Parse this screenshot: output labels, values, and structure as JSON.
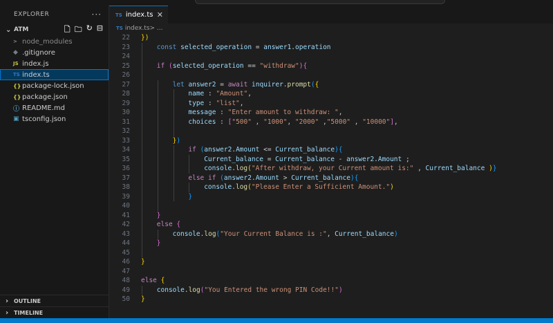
{
  "explorer": {
    "title": "EXPLORER",
    "more": "···",
    "folder": "ATM",
    "items": [
      {
        "label": "node_modules",
        "icon": "chevron-right-icon",
        "glyph": ">",
        "kind": "folder",
        "selected": false
      },
      {
        "label": ".gitignore",
        "icon": "git-icon",
        "glyph": "◆",
        "kind": "git",
        "selected": false
      },
      {
        "label": "index.js",
        "icon": "js-file-icon",
        "glyph": "JS",
        "kind": "js",
        "selected": false
      },
      {
        "label": "index.ts",
        "icon": "ts-file-icon",
        "glyph": "TS",
        "kind": "ts",
        "selected": true
      },
      {
        "label": "package-lock.json",
        "icon": "json-file-icon",
        "glyph": "{}",
        "kind": "json",
        "selected": false
      },
      {
        "label": "package.json",
        "icon": "json-file-icon",
        "glyph": "{}",
        "kind": "json",
        "selected": false
      },
      {
        "label": "README.md",
        "icon": "info-icon",
        "glyph": "ⓘ",
        "kind": "info",
        "selected": false
      },
      {
        "label": "tsconfig.json",
        "icon": "tsconfig-file-icon",
        "glyph": "▣",
        "kind": "cfg",
        "selected": false
      }
    ],
    "outline": "OUTLINE",
    "timeline": "TIMELINE"
  },
  "tab": {
    "label": "index.ts",
    "badge": "TS",
    "close": "✕"
  },
  "breadcrumb": {
    "file": "index.ts",
    "rest": " > ..."
  },
  "code": [
    {
      "n": "22",
      "i": 0,
      "t": [
        [
          "pn",
          "})"
        ]
      ]
    },
    {
      "n": "23",
      "i": 1,
      "t": [
        [
          "kw",
          "const "
        ],
        [
          "v",
          "selected_operation"
        ],
        [
          "",
          " = "
        ],
        [
          "v",
          "answer1"
        ],
        [
          "",
          "."
        ],
        [
          "v",
          "operation"
        ]
      ]
    },
    {
      "n": "24",
      "i": 1,
      "t": []
    },
    {
      "n": "25",
      "i": 1,
      "t": [
        [
          "ctl",
          "if "
        ],
        [
          "pm",
          "("
        ],
        [
          "v",
          "selected_operation"
        ],
        [
          "",
          " == "
        ],
        [
          "str",
          "\"withdraw\""
        ],
        [
          "pm",
          ")"
        ],
        [
          "pm",
          "{"
        ]
      ]
    },
    {
      "n": "26",
      "i": 1,
      "t": []
    },
    {
      "n": "27",
      "i": 2,
      "t": [
        [
          "kw",
          "let "
        ],
        [
          "v",
          "answer2"
        ],
        [
          "",
          " = "
        ],
        [
          "ctl",
          "await "
        ],
        [
          "v",
          "inquirer"
        ],
        [
          "",
          "."
        ],
        [
          "fn",
          "prompt"
        ],
        [
          "pb",
          "("
        ],
        [
          "pn",
          "{"
        ]
      ]
    },
    {
      "n": "28",
      "i": 3,
      "t": [
        [
          "v",
          "name"
        ],
        [
          "",
          " : "
        ],
        [
          "str",
          "\"Amount\""
        ],
        [
          "",
          ","
        ]
      ]
    },
    {
      "n": "29",
      "i": 3,
      "t": [
        [
          "v",
          "type"
        ],
        [
          "",
          " : "
        ],
        [
          "str",
          "\"list\""
        ],
        [
          "",
          ","
        ]
      ]
    },
    {
      "n": "30",
      "i": 3,
      "t": [
        [
          "v",
          "message"
        ],
        [
          "",
          " : "
        ],
        [
          "str",
          "\"Enter amount to withdraw: \""
        ],
        [
          "",
          ","
        ]
      ]
    },
    {
      "n": "31",
      "i": 3,
      "t": [
        [
          "v",
          "choices"
        ],
        [
          "",
          " : "
        ],
        [
          "pm",
          "["
        ],
        [
          "str",
          "\"500\""
        ],
        [
          "",
          " , "
        ],
        [
          "str",
          "\"1000\""
        ],
        [
          "",
          ", "
        ],
        [
          "str",
          "\"2000\""
        ],
        [
          "",
          " ,"
        ],
        [
          "str",
          "\"5000\""
        ],
        [
          "",
          " , "
        ],
        [
          "str",
          "\"10000\""
        ],
        [
          "pm",
          "]"
        ],
        [
          "",
          ","
        ]
      ]
    },
    {
      "n": "32",
      "i": 3,
      "t": []
    },
    {
      "n": "33",
      "i": 2,
      "t": [
        [
          "pn",
          "}"
        ],
        [
          "pb",
          ")"
        ]
      ]
    },
    {
      "n": "34",
      "i": 3,
      "t": [
        [
          "ctl",
          "if "
        ],
        [
          "pb",
          "("
        ],
        [
          "v",
          "answer2"
        ],
        [
          "",
          "."
        ],
        [
          "v",
          "Amount"
        ],
        [
          "",
          " <= "
        ],
        [
          "v",
          "Current_balance"
        ],
        [
          "pb",
          ")"
        ],
        [
          "pb",
          "{"
        ]
      ]
    },
    {
      "n": "35",
      "i": 4,
      "t": [
        [
          "v",
          "Current_balance"
        ],
        [
          "",
          " = "
        ],
        [
          "v",
          "Current_balance"
        ],
        [
          "",
          " - "
        ],
        [
          "v",
          "answer2"
        ],
        [
          "",
          "."
        ],
        [
          "v",
          "Amount"
        ],
        [
          "",
          " ;"
        ]
      ]
    },
    {
      "n": "36",
      "i": 4,
      "t": [
        [
          "v",
          "console"
        ],
        [
          "",
          "."
        ],
        [
          "fn",
          "log"
        ],
        [
          "pn",
          "("
        ],
        [
          "str",
          "\"After withdraw, your Current amount is:\""
        ],
        [
          "",
          " , "
        ],
        [
          "v",
          "Current_balance"
        ],
        [
          "",
          " "
        ],
        [
          "pn",
          ")"
        ],
        [
          "pb",
          "}"
        ]
      ]
    },
    {
      "n": "37",
      "i": 3,
      "t": [
        [
          "ctl",
          "else "
        ],
        [
          "ctl",
          "if "
        ],
        [
          "pb",
          "("
        ],
        [
          "v",
          "answer2"
        ],
        [
          "",
          "."
        ],
        [
          "v",
          "Amount"
        ],
        [
          "",
          " > "
        ],
        [
          "v",
          "Current_balance"
        ],
        [
          "pb",
          ")"
        ],
        [
          "pb",
          "{"
        ]
      ]
    },
    {
      "n": "38",
      "i": 4,
      "t": [
        [
          "v",
          "console"
        ],
        [
          "",
          "."
        ],
        [
          "fn",
          "log"
        ],
        [
          "pn",
          "("
        ],
        [
          "str",
          "\"Please Enter a Sufficient Amount.\""
        ],
        [
          "pn",
          ")"
        ]
      ]
    },
    {
      "n": "39",
      "i": 3,
      "t": [
        [
          "pb",
          "}"
        ]
      ]
    },
    {
      "n": "40",
      "i": 2,
      "t": []
    },
    {
      "n": "41",
      "i": 1,
      "t": [
        [
          "pm",
          "}"
        ]
      ]
    },
    {
      "n": "42",
      "i": 1,
      "t": [
        [
          "ctl",
          "else "
        ],
        [
          "pm",
          "{"
        ]
      ]
    },
    {
      "n": "43",
      "i": 2,
      "t": [
        [
          "v",
          "console"
        ],
        [
          "",
          "."
        ],
        [
          "fn",
          "log"
        ],
        [
          "pb",
          "("
        ],
        [
          "str",
          "\"Your Current Balance is :\""
        ],
        [
          "",
          ", "
        ],
        [
          "v",
          "Current_balance"
        ],
        [
          "pb",
          ")"
        ]
      ]
    },
    {
      "n": "44",
      "i": 1,
      "t": [
        [
          "pm",
          "}"
        ]
      ]
    },
    {
      "n": "45",
      "i": 1,
      "t": []
    },
    {
      "n": "46",
      "i": 0,
      "t": [
        [
          "pn",
          "}"
        ]
      ]
    },
    {
      "n": "47",
      "i": 0,
      "t": []
    },
    {
      "n": "48",
      "i": 0,
      "t": [
        [
          "ctl",
          "else "
        ],
        [
          "pn",
          "{"
        ]
      ]
    },
    {
      "n": "49",
      "i": 1,
      "t": [
        [
          "v",
          "console"
        ],
        [
          "",
          "."
        ],
        [
          "fn",
          "log"
        ],
        [
          "pm",
          "("
        ],
        [
          "str",
          "\"You Entered the wrong PIN Code!!\""
        ],
        [
          "pm",
          ")"
        ]
      ]
    },
    {
      "n": "50",
      "i": 0,
      "t": [
        [
          "pn",
          "}"
        ]
      ]
    }
  ],
  "colors": {
    "accent": "#0078d4",
    "selection": "#04395e",
    "statusbar": "#007acc",
    "editor_bg": "#1e1e1e"
  }
}
